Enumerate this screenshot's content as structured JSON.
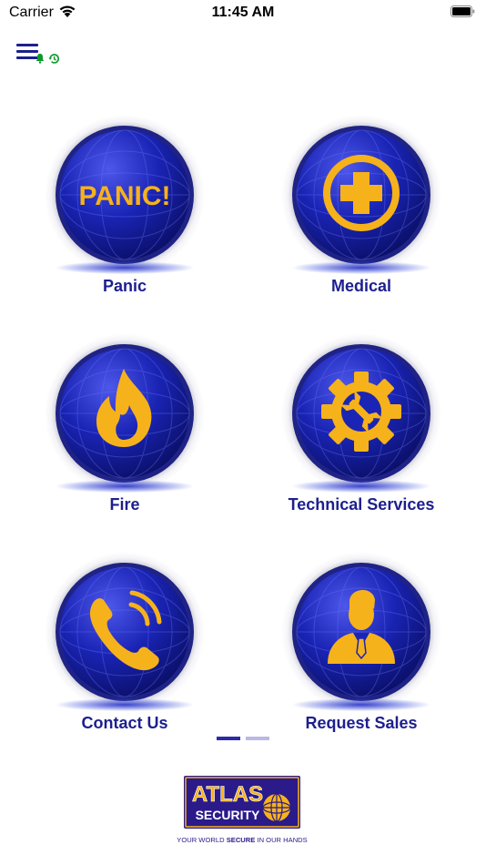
{
  "status_bar": {
    "carrier": "Carrier",
    "time": "11:45 AM"
  },
  "toolbar": {
    "menu_icon": "hamburger-menu-icon",
    "bell_icon": "bell-icon",
    "history_icon": "history-icon"
  },
  "tiles": [
    {
      "label": "Panic",
      "icon_text": "PANIC!",
      "icon": "panic-text-icon"
    },
    {
      "label": "Medical",
      "icon": "medical-cross-icon"
    },
    {
      "label": "Fire",
      "icon": "flame-icon"
    },
    {
      "label": "Technical Services",
      "icon": "gear-wrench-icon"
    },
    {
      "label": "Contact Us",
      "icon": "phone-icon"
    },
    {
      "label": "Request Sales",
      "icon": "salesperson-icon"
    }
  ],
  "pager": {
    "current_page": 1,
    "total_pages": 2
  },
  "logo": {
    "line1": "ATLAS",
    "line2": "SECURITY",
    "tagline_prefix": "YOUR WORLD ",
    "tagline_bold": "SECURE",
    "tagline_suffix": " IN OUR HANDS"
  },
  "colors": {
    "brand_navy": "#1d1f8e",
    "accent_gold": "#f6b21b",
    "indicator_active": "#2b2ba8",
    "indicator_inactive": "#b9b9e6"
  }
}
